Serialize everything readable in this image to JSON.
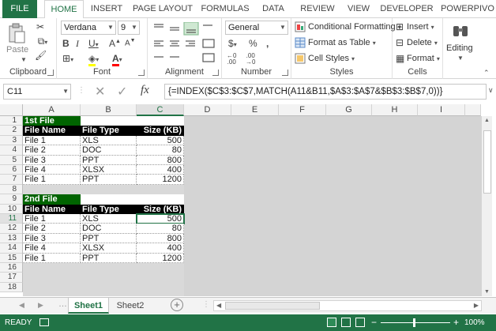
{
  "tabs": {
    "file": "FILE",
    "items": [
      "HOME",
      "INSERT",
      "PAGE LAYOUT",
      "FORMULAS",
      "DATA",
      "REVIEW",
      "VIEW",
      "DEVELOPER",
      "POWERPIVO"
    ]
  },
  "ribbon": {
    "clipboard": {
      "label": "Clipboard",
      "paste": "Paste"
    },
    "font": {
      "label": "Font",
      "name": "Verdana",
      "size": "9"
    },
    "alignment": {
      "label": "Alignment"
    },
    "number": {
      "label": "Number",
      "format": "General"
    },
    "styles": {
      "label": "Styles",
      "conditional": "Conditional Formatting",
      "format_table": "Format as Table",
      "cell_styles": "Cell Styles"
    },
    "cells": {
      "label": "Cells",
      "insert": "Insert",
      "delete": "Delete",
      "format": "Format"
    },
    "editing": {
      "label": "Editing"
    }
  },
  "formula_bar": {
    "name_box": "C11",
    "fx": "fx",
    "formula": "{=INDEX($C$3:$C$7,MATCH(A11&B11,$A$3:$A$7&$B$3:$B$7,0))}"
  },
  "grid": {
    "columns": [
      "A",
      "B",
      "C",
      "D",
      "E",
      "F",
      "G",
      "H",
      "I"
    ],
    "rows": [
      "1",
      "2",
      "3",
      "4",
      "5",
      "6",
      "7",
      "8",
      "9",
      "10",
      "11",
      "12",
      "13",
      "14",
      "15",
      "16",
      "17",
      "18"
    ],
    "table1": {
      "title": "1st File",
      "headers": [
        "File Name",
        "File Type",
        "Size (KB)"
      ],
      "rows": [
        [
          "File 1",
          "XLS",
          "500"
        ],
        [
          "File 2",
          "DOC",
          "80"
        ],
        [
          "File 3",
          "PPT",
          "800"
        ],
        [
          "File 4",
          "XLSX",
          "400"
        ],
        [
          "File 1",
          "PPT",
          "1200"
        ]
      ]
    },
    "table2": {
      "title": "2nd File",
      "headers": [
        "File Name",
        "File Type",
        "Size (KB)"
      ],
      "rows": [
        [
          "File 1",
          "XLS",
          "500"
        ],
        [
          "File 2",
          "DOC",
          "80"
        ],
        [
          "File 3",
          "PPT",
          "800"
        ],
        [
          "File 4",
          "XLSX",
          "400"
        ],
        [
          "File 1",
          "PPT",
          "1200"
        ]
      ]
    }
  },
  "sheets": {
    "tabs": [
      "Sheet1",
      "Sheet2"
    ],
    "active": "Sheet1"
  },
  "status": {
    "ready": "READY",
    "zoom": "100%"
  },
  "colors": {
    "accent": "#217346",
    "title_fill": "#006400",
    "header_fill": "#000000"
  }
}
